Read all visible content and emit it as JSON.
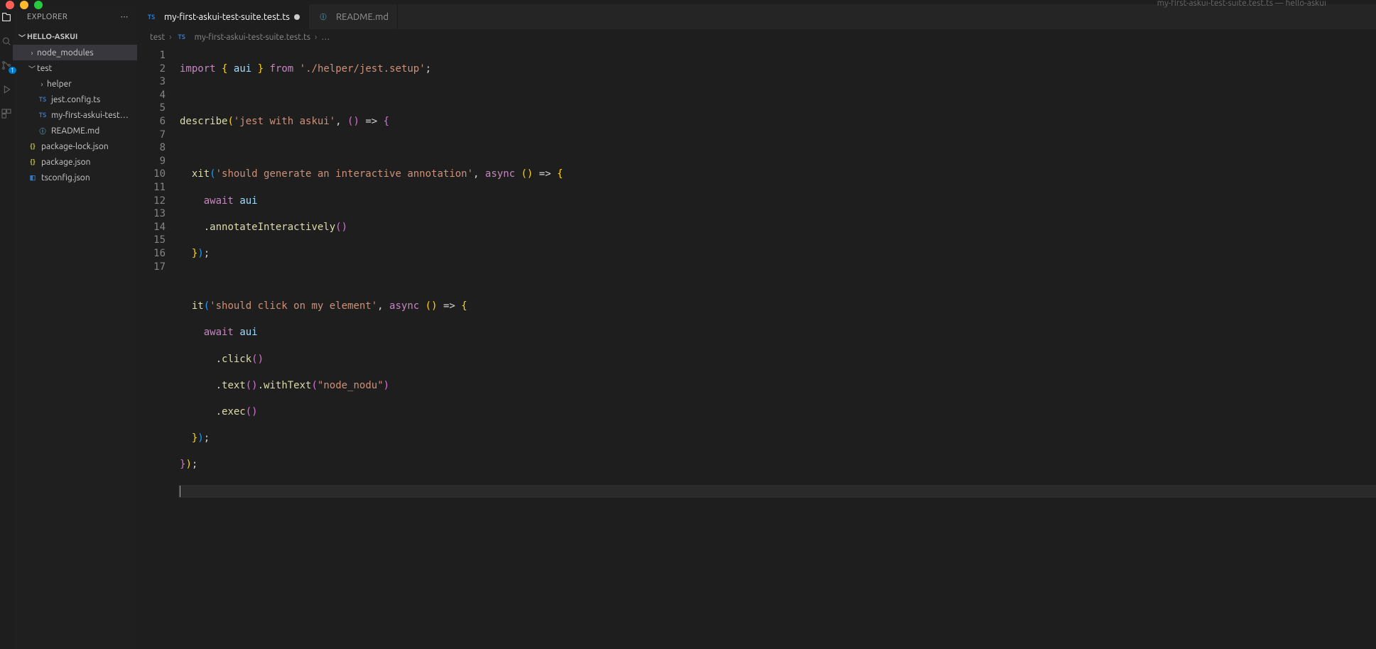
{
  "window_title": "my-first-askui-test-suite.test.ts — hello-askui",
  "activity": {
    "scm_badge": "1"
  },
  "sidebar": {
    "header": "EXPLORER",
    "project": "HELLO-ASKUI",
    "node_modules": "node_modules",
    "test": "test",
    "helper": "helper",
    "jest_config": "jest.config.ts",
    "testfile": "my-first-askui-test…",
    "readme": "README.md",
    "pkg_lock": "package-lock.json",
    "pkg": "package.json",
    "tsconfig": "tsconfig.json"
  },
  "tabs": {
    "active": "my-first-askui-test-suite.test.ts",
    "second": "README.md"
  },
  "breadcrumb": {
    "seg0": "test",
    "seg1": "my-first-askui-test-suite.test.ts",
    "seg2": "…"
  },
  "code": {
    "import_kw": "import",
    "from_kw": "from",
    "aui": "aui",
    "setup_path": "'./helper/jest.setup'",
    "describe": "describe",
    "desc_str": "'jest with askui'",
    "xit": "xit",
    "xit_str": "'should generate an interactive annotation'",
    "async": "async",
    "await": "await",
    "annotate": "annotateInteractively",
    "it": "it",
    "it_str": "'should click on my element'",
    "click": "click",
    "text": "text",
    "withText": "withText",
    "withText_arg": "\"node_nodu\"",
    "exec": "exec"
  },
  "line_numbers": [
    "1",
    "2",
    "3",
    "4",
    "5",
    "6",
    "7",
    "8",
    "9",
    "10",
    "11",
    "12",
    "13",
    "14",
    "15",
    "16",
    "17"
  ]
}
